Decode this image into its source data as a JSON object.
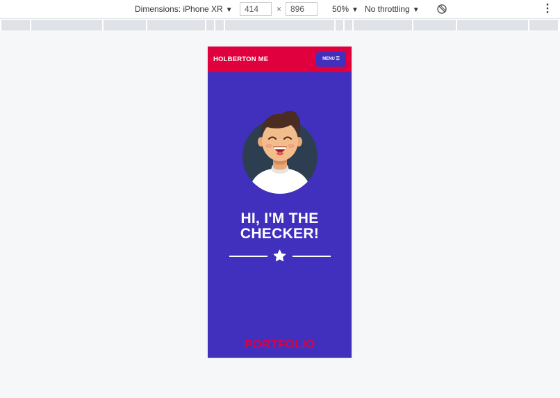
{
  "devtools": {
    "dimensions_label": "Dimensions: iPhone XR",
    "width_value": "414",
    "height_value": "896",
    "times_symbol": "×",
    "zoom_label": "50%",
    "throttling_label": "No throttling",
    "dropdown_caret": "▼",
    "more_symbol": "⋮"
  },
  "page": {
    "brand": "HOLBERTON ME",
    "menu_label": "MENU ☰",
    "hero_line1": "HI, I'M THE",
    "hero_line2": "CHECKER!",
    "section_title": "PORTFOLIO"
  },
  "colors": {
    "primary": "#4130bd",
    "accent": "#e1003e",
    "avatar_bg": "#2c3e50"
  },
  "icons": [
    "rotate-icon",
    "more-options-icon",
    "menu-icon",
    "avatar-image",
    "star-icon"
  ]
}
